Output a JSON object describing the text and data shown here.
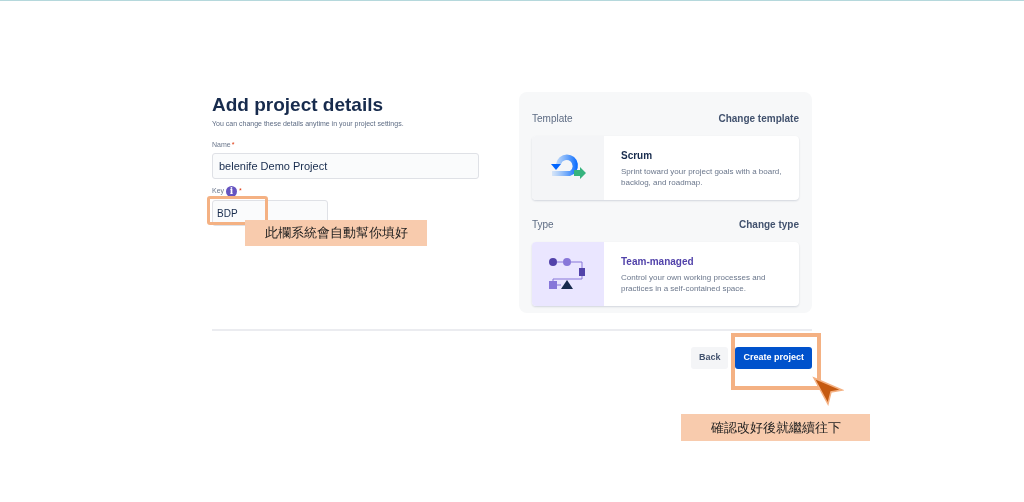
{
  "header": {
    "title": "Add project details",
    "subtitle": "You can change these details anytime in your project settings."
  },
  "form": {
    "name": {
      "label": "Name",
      "required": "*",
      "value": "belenife Demo Project"
    },
    "key": {
      "label": "Key",
      "info": "i",
      "required": "*",
      "value": "BDP"
    }
  },
  "template": {
    "heading": "Template",
    "action": "Change template",
    "title": "Scrum",
    "description": "Sprint toward your project goals with a board, backlog, and roadmap."
  },
  "type": {
    "heading": "Type",
    "action": "Change type",
    "title": "Team-managed",
    "description": "Control your own working processes and practices in a self-contained space."
  },
  "buttons": [
    {
      "kind": "secondary",
      "label": "Back"
    },
    {
      "kind": "primary",
      "label": "Create project"
    }
  ],
  "annotations": [
    {
      "text": "此欄系統會自動幫你填好"
    },
    {
      "text": "確認改好後就繼續往下"
    }
  ]
}
